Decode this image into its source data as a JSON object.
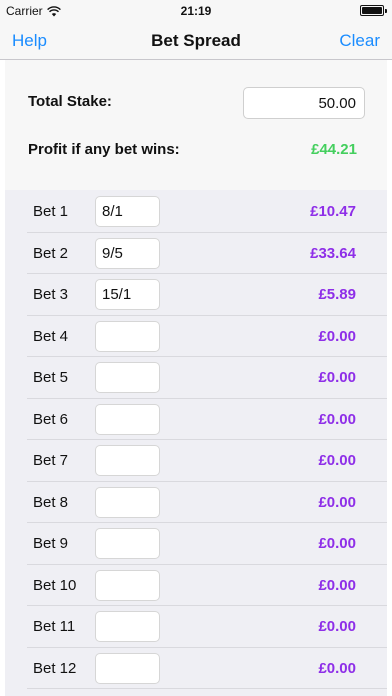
{
  "status_bar": {
    "carrier": "Carrier",
    "time": "21:19"
  },
  "nav": {
    "left_label": "Help",
    "title": "Bet Spread",
    "right_label": "Clear"
  },
  "summary": {
    "stake_label": "Total Stake:",
    "stake_value": "50.00",
    "profit_label": "Profit if any bet wins:",
    "profit_value": "£44.21"
  },
  "bets": [
    {
      "label": "Bet 1",
      "odds": "8/1",
      "value": "£10.47"
    },
    {
      "label": "Bet 2",
      "odds": "9/5",
      "value": "£33.64"
    },
    {
      "label": "Bet 3",
      "odds": "15/1",
      "value": "£5.89"
    },
    {
      "label": "Bet 4",
      "odds": "",
      "value": "£0.00"
    },
    {
      "label": "Bet 5",
      "odds": "",
      "value": "£0.00"
    },
    {
      "label": "Bet 6",
      "odds": "",
      "value": "£0.00"
    },
    {
      "label": "Bet 7",
      "odds": "",
      "value": "£0.00"
    },
    {
      "label": "Bet 8",
      "odds": "",
      "value": "£0.00"
    },
    {
      "label": "Bet 9",
      "odds": "",
      "value": "£0.00"
    },
    {
      "label": "Bet 10",
      "odds": "",
      "value": "£0.00"
    },
    {
      "label": "Bet 11",
      "odds": "",
      "value": "£0.00"
    },
    {
      "label": "Bet 12",
      "odds": "",
      "value": "£0.00"
    }
  ],
  "colors": {
    "accent": "#1a8cff",
    "profit": "#44cf5e",
    "bet_value": "#8e2ee8"
  },
  "icons": [
    "wifi-icon",
    "battery-icon"
  ]
}
